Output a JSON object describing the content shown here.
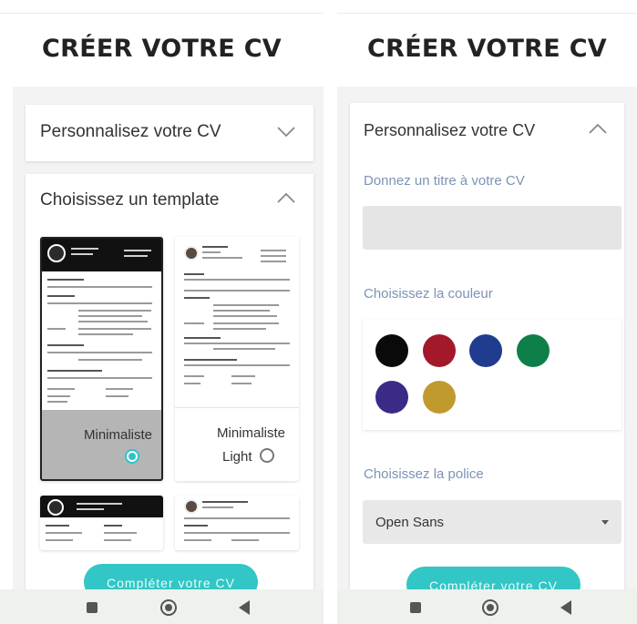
{
  "left": {
    "title": "CRÉER VOTRE CV",
    "accordion_personalize": {
      "label": "Personnalisez votre CV",
      "expanded": false
    },
    "accordion_template": {
      "label": "Choisissez un template",
      "expanded": true
    },
    "templates": [
      {
        "name": "Minimaliste",
        "selected": true
      },
      {
        "name": "Minimaliste\nLight",
        "name_line1": "Minimaliste",
        "name_line2": "Light",
        "selected": false
      }
    ],
    "cta_label": "Compléter votre CV"
  },
  "right": {
    "title": "CRÉER VOTRE CV",
    "accordion_personalize": {
      "label": "Personnalisez votre CV",
      "expanded": true
    },
    "title_field_label": "Donnez un titre à votre CV",
    "title_field_value": "",
    "color_label": "Choisissez la couleur",
    "colors": [
      "#0a0a0a",
      "#a3182a",
      "#1f3c8e",
      "#0f7f4a",
      "#3b2a86",
      "#c19a2e"
    ],
    "font_label": "Choisissez la police",
    "font_value": "Open Sans",
    "cta_label": "Compléter votre CV"
  },
  "accent": "#32c6c6",
  "icons": [
    "chevron-down-icon",
    "chevron-up-icon",
    "radio-selected-icon",
    "radio-empty-icon",
    "dropdown-caret-icon",
    "nav-recents-icon",
    "nav-home-icon",
    "nav-back-icon"
  ]
}
